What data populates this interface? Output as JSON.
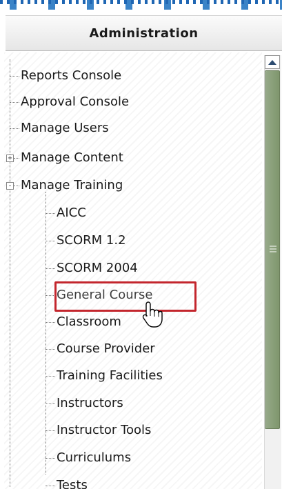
{
  "panel": {
    "title": "Administration"
  },
  "tree": {
    "top_items": [
      {
        "label": "Reports Console"
      },
      {
        "label": "Approval Console"
      },
      {
        "label": "Manage Users"
      },
      {
        "label": "Manage Content",
        "expander": "+"
      },
      {
        "label": "Manage Training",
        "expander": "-"
      }
    ],
    "training_children": [
      {
        "label": "AICC"
      },
      {
        "label": "SCORM 1.2"
      },
      {
        "label": "SCORM 2004"
      },
      {
        "label": "General Course"
      },
      {
        "label": "Classroom"
      },
      {
        "label": "Course Provider"
      },
      {
        "label": "Training Facilities"
      },
      {
        "label": "Instructors"
      },
      {
        "label": "Instructor Tools"
      },
      {
        "label": "Curriculums"
      },
      {
        "label": "Tests"
      }
    ]
  },
  "colors": {
    "highlight": "#c3262d",
    "scroll_thumb": "#8aa07a",
    "top_band": "#3a83c7"
  },
  "icons": {
    "cursor": "hand-pointer-icon",
    "scroll_up": "scroll-up-arrow-icon"
  }
}
